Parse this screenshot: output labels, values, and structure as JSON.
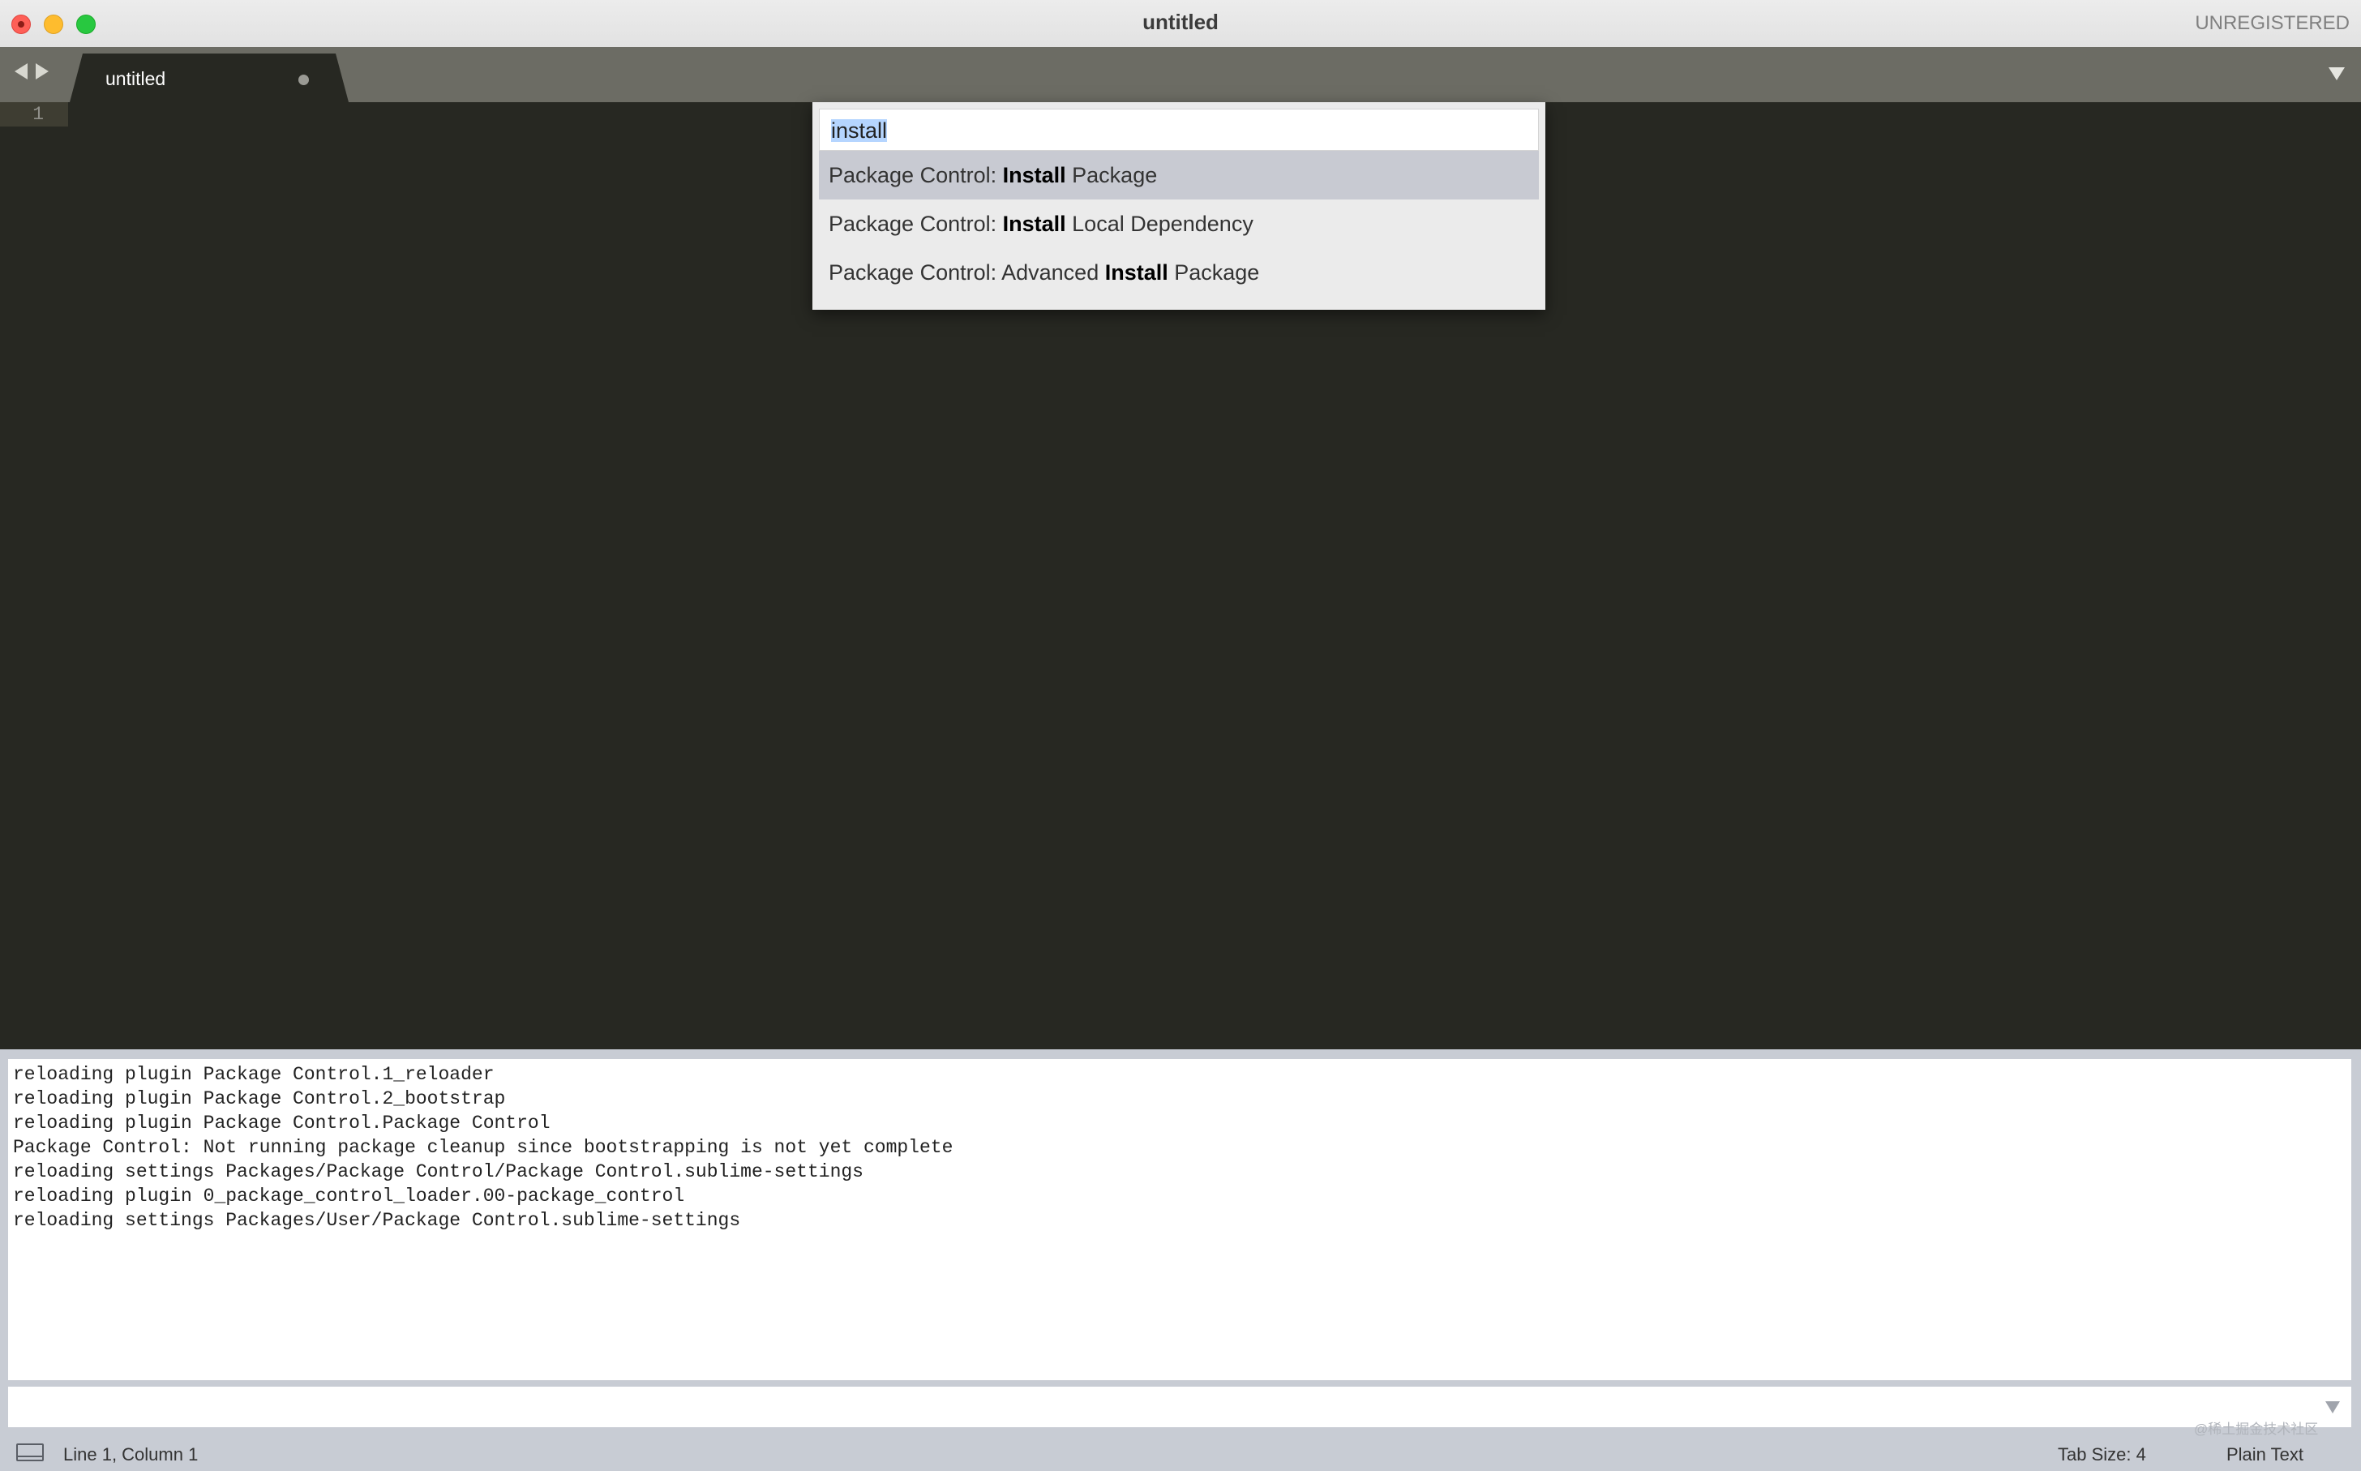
{
  "window": {
    "title": "untitled",
    "registration": "UNREGISTERED"
  },
  "tabs": [
    {
      "label": "untitled",
      "modified": true
    }
  ],
  "editor": {
    "line_numbers": [
      "1"
    ]
  },
  "command_palette": {
    "query": "install",
    "items": [
      {
        "prefix": "Package Control: ",
        "match": "Install",
        "suffix": " Package",
        "selected": true
      },
      {
        "prefix": "Package Control: ",
        "match": "Install",
        "suffix": " Local Dependency",
        "selected": false
      },
      {
        "prefix": "Package Control: Advanced ",
        "match": "Install",
        "suffix": " Package",
        "selected": false
      }
    ]
  },
  "console": {
    "lines": [
      "reloading plugin Package Control.1_reloader",
      "reloading plugin Package Control.2_bootstrap",
      "reloading plugin Package Control.Package Control",
      "Package Control: Not running package cleanup since bootstrapping is not yet complete",
      "reloading settings Packages/Package Control/Package Control.sublime-settings",
      "reloading plugin 0_package_control_loader.00-package_control",
      "reloading settings Packages/User/Package Control.sublime-settings"
    ]
  },
  "statusbar": {
    "position": "Line 1, Column 1",
    "tab_size": "Tab Size: 4",
    "syntax": "Plain Text"
  },
  "watermark": "@稀土掘金技术社区",
  "colors": {
    "editor_bg": "#272822",
    "tabbar_bg": "#6c6c64",
    "palette_bg": "#ebebeb",
    "palette_selected": "#c8cad2",
    "statusbar_bg": "#c8ccd4"
  },
  "icons": {
    "close": "close-window-icon",
    "minimize": "minimize-window-icon",
    "maximize": "maximize-window-icon",
    "nav_back": "arrow-left-icon",
    "nav_forward": "arrow-right-icon",
    "tab_menu": "chevron-down-icon",
    "panel_toggle": "panel-toggle-icon"
  }
}
